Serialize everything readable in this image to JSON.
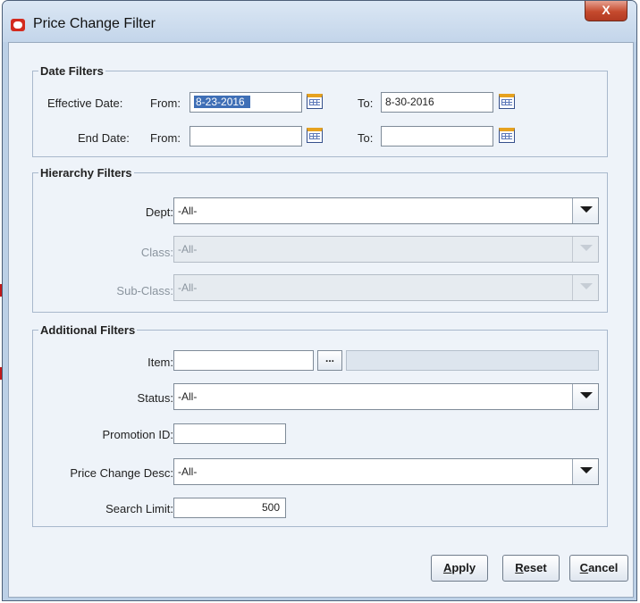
{
  "window": {
    "title": "Price Change Filter",
    "close_glyph": "X"
  },
  "date_filters": {
    "legend": "Date Filters",
    "effective_label": "Effective Date:",
    "end_label": "End Date:",
    "from_label": "From:",
    "to_label": "To:",
    "effective_from": "8-23-2016",
    "effective_to": "8-30-2016",
    "end_from": "",
    "end_to": ""
  },
  "hierarchy_filters": {
    "legend": "Hierarchy Filters",
    "dept_label": "Dept:",
    "dept_value": "-All-",
    "class_label": "Class:",
    "class_value": "-All-",
    "subclass_label": "Sub-Class:",
    "subclass_value": "-All-"
  },
  "additional_filters": {
    "legend": "Additional Filters",
    "item_label": "Item:",
    "item_value": "",
    "item_browse_label": "...",
    "status_label": "Status:",
    "status_value": "-All-",
    "promotion_label": "Promotion ID:",
    "promotion_value": "",
    "desc_label": "Price Change Desc:",
    "desc_value": "-All-",
    "limit_label": "Search Limit:",
    "limit_value": "500"
  },
  "buttons": {
    "apply_acc": "A",
    "apply_rest": "pply",
    "reset_acc": "R",
    "reset_rest": "eset",
    "cancel_acc": "C",
    "cancel_rest": "ancel"
  },
  "icons": {
    "app": "oracle-logo-icon",
    "calendar": "calendar-icon",
    "dropdown": "chevron-down-icon",
    "close": "close-icon"
  },
  "colors": {
    "accent": "#3f6fb6",
    "titlebar": "#c3d5ea",
    "close": "#c54a2e"
  }
}
